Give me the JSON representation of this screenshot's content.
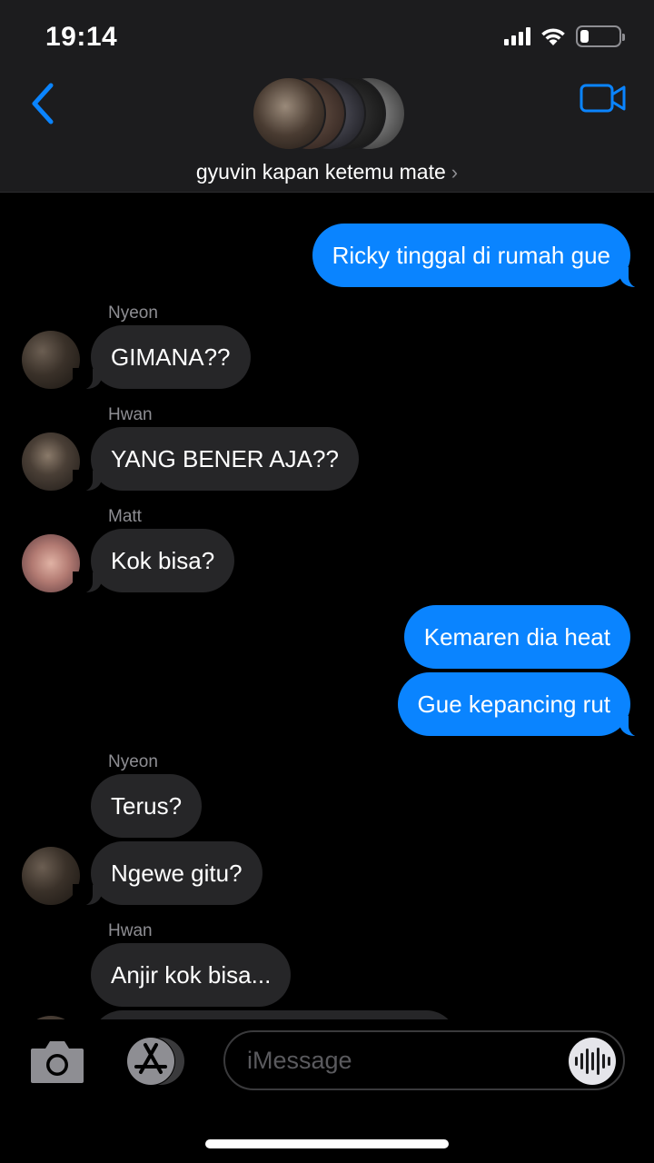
{
  "status_bar": {
    "time": "19:14",
    "battery_level": 0.22
  },
  "header": {
    "group_name": "gyuvin kapan ketemu mate",
    "icons": {
      "back": "chevron-left-icon",
      "video": "video-camera-icon",
      "title_chevron": "chevron-right-icon"
    }
  },
  "messages": [
    {
      "direction": "out",
      "text": "Ricky tinggal di rumah gue"
    },
    {
      "direction": "in",
      "sender": "Nyeon",
      "text": "GIMANA??"
    },
    {
      "direction": "in",
      "sender": "Hwan",
      "text": "YANG BENER AJA??"
    },
    {
      "direction": "in",
      "sender": "Matt",
      "text": "Kok bisa?"
    },
    {
      "direction": "out",
      "text": "Kemaren dia heat"
    },
    {
      "direction": "out",
      "text": "Gue kepancing rut"
    },
    {
      "direction": "in",
      "sender": "Nyeon",
      "text": "Terus?"
    },
    {
      "direction": "in",
      "text": "Ngewe gitu?"
    },
    {
      "direction": "in",
      "sender": "Hwan",
      "text": "Anjir kok bisa..."
    }
  ],
  "input_bar": {
    "placeholder": "iMessage",
    "value": "",
    "icons": {
      "camera": "camera-icon",
      "app_store": "app-store-icon",
      "audio": "audio-waveform-icon"
    }
  },
  "colors": {
    "outgoing": "#0a84ff",
    "incoming": "#262628",
    "header_bg": "#1c1c1e",
    "accent": "#0a84ff"
  }
}
